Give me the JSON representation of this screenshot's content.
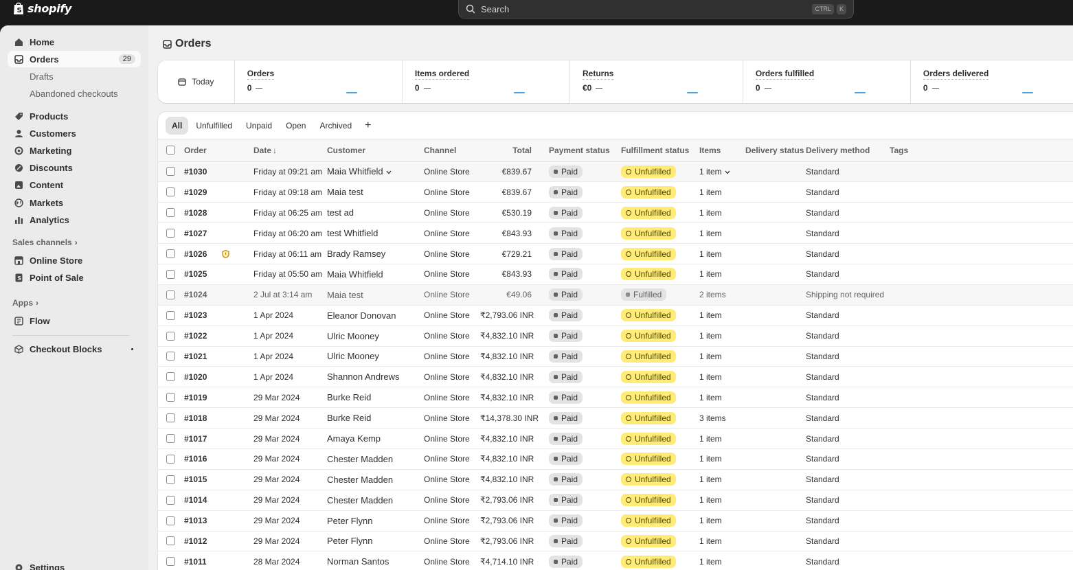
{
  "topbar": {
    "brand": "shopify",
    "search_placeholder": "Search",
    "shortcut_ctrl": "CTRL",
    "shortcut_key": "K"
  },
  "sidebar": {
    "home": "Home",
    "orders": "Orders",
    "orders_count": "29",
    "drafts": "Drafts",
    "abandoned": "Abandoned checkouts",
    "products": "Products",
    "customers": "Customers",
    "marketing": "Marketing",
    "discounts": "Discounts",
    "content": "Content",
    "markets": "Markets",
    "analytics": "Analytics",
    "sales_channels": "Sales channels",
    "online_store": "Online Store",
    "pos": "Point of Sale",
    "apps": "Apps",
    "flow": "Flow",
    "checkout_blocks": "Checkout Blocks",
    "settings": "Settings"
  },
  "page": {
    "title": "Orders"
  },
  "metrics": {
    "period": "Today",
    "items": [
      {
        "label": "Orders",
        "value": "0"
      },
      {
        "label": "Items ordered",
        "value": "0"
      },
      {
        "label": "Returns",
        "value": "€0"
      },
      {
        "label": "Orders fulfilled",
        "value": "0"
      },
      {
        "label": "Orders delivered",
        "value": "0"
      }
    ]
  },
  "tabs": [
    "All",
    "Unfulfilled",
    "Unpaid",
    "Open",
    "Archived"
  ],
  "table": {
    "headers": {
      "order": "Order",
      "date": "Date",
      "customer": "Customer",
      "channel": "Channel",
      "total": "Total",
      "payment": "Payment status",
      "fulfillment": "Fulfillment status",
      "items": "Items",
      "delivery_status": "Delivery status",
      "delivery_method": "Delivery method",
      "tags": "Tags"
    },
    "rows": [
      {
        "order": "#1030",
        "date": "Friday at 09:21 am",
        "customer": "Maia Whitfield",
        "channel": "Online Store",
        "total": "€839.67",
        "payment": "Paid",
        "fulfillment": "Unfulfilled",
        "items": "1 item",
        "delivery_method": "Standard"
      },
      {
        "order": "#1029",
        "date": "Friday at 09:18 am",
        "customer": "Maia test",
        "channel": "Online Store",
        "total": "€839.67",
        "payment": "Paid",
        "fulfillment": "Unfulfilled",
        "items": "1 item",
        "delivery_method": "Standard"
      },
      {
        "order": "#1028",
        "date": "Friday at 06:25 am",
        "customer": "test ad",
        "channel": "Online Store",
        "total": "€530.19",
        "payment": "Paid",
        "fulfillment": "Unfulfilled",
        "items": "1 item",
        "delivery_method": "Standard"
      },
      {
        "order": "#1027",
        "date": "Friday at 06:20 am",
        "customer": "test Whitfield",
        "channel": "Online Store",
        "total": "€843.93",
        "payment": "Paid",
        "fulfillment": "Unfulfilled",
        "items": "1 item",
        "delivery_method": "Standard"
      },
      {
        "order": "#1026",
        "date": "Friday at 06:11 am",
        "customer": "Brady Ramsey",
        "channel": "Online Store",
        "total": "€729.21",
        "payment": "Paid",
        "fulfillment": "Unfulfilled",
        "items": "1 item",
        "delivery_method": "Standard"
      },
      {
        "order": "#1025",
        "date": "Friday at 05:50 am",
        "customer": "Maia Whitfield",
        "channel": "Online Store",
        "total": "€843.93",
        "payment": "Paid",
        "fulfillment": "Unfulfilled",
        "items": "1 item",
        "delivery_method": "Standard"
      },
      {
        "order": "#1024",
        "date": "2 Jul at 3:14 am",
        "customer": "Maia test",
        "channel": "Online Store",
        "total": "€49.06",
        "payment": "Paid",
        "fulfillment": "Fulfilled",
        "items": "2 items",
        "delivery_method": "Shipping not required"
      },
      {
        "order": "#1023",
        "date": "1 Apr 2024",
        "customer": "Eleanor Donovan",
        "channel": "Online Store",
        "total": "₹2,793.06 INR",
        "payment": "Paid",
        "fulfillment": "Unfulfilled",
        "items": "1 item",
        "delivery_method": "Standard"
      },
      {
        "order": "#1022",
        "date": "1 Apr 2024",
        "customer": "Ulric Mooney",
        "channel": "Online Store",
        "total": "₹4,832.10 INR",
        "payment": "Paid",
        "fulfillment": "Unfulfilled",
        "items": "1 item",
        "delivery_method": "Standard"
      },
      {
        "order": "#1021",
        "date": "1 Apr 2024",
        "customer": "Ulric Mooney",
        "channel": "Online Store",
        "total": "₹4,832.10 INR",
        "payment": "Paid",
        "fulfillment": "Unfulfilled",
        "items": "1 item",
        "delivery_method": "Standard"
      },
      {
        "order": "#1020",
        "date": "1 Apr 2024",
        "customer": "Shannon Andrews",
        "channel": "Online Store",
        "total": "₹4,832.10 INR",
        "payment": "Paid",
        "fulfillment": "Unfulfilled",
        "items": "1 item",
        "delivery_method": "Standard"
      },
      {
        "order": "#1019",
        "date": "29 Mar 2024",
        "customer": "Burke Reid",
        "channel": "Online Store",
        "total": "₹4,832.10 INR",
        "payment": "Paid",
        "fulfillment": "Unfulfilled",
        "items": "1 item",
        "delivery_method": "Standard"
      },
      {
        "order": "#1018",
        "date": "29 Mar 2024",
        "customer": "Burke Reid",
        "channel": "Online Store",
        "total": "₹14,378.30 INR",
        "payment": "Paid",
        "fulfillment": "Unfulfilled",
        "items": "3 items",
        "delivery_method": "Standard"
      },
      {
        "order": "#1017",
        "date": "29 Mar 2024",
        "customer": "Amaya Kemp",
        "channel": "Online Store",
        "total": "₹4,832.10 INR",
        "payment": "Paid",
        "fulfillment": "Unfulfilled",
        "items": "1 item",
        "delivery_method": "Standard"
      },
      {
        "order": "#1016",
        "date": "29 Mar 2024",
        "customer": "Chester Madden",
        "channel": "Online Store",
        "total": "₹4,832.10 INR",
        "payment": "Paid",
        "fulfillment": "Unfulfilled",
        "items": "1 item",
        "delivery_method": "Standard"
      },
      {
        "order": "#1015",
        "date": "29 Mar 2024",
        "customer": "Chester Madden",
        "channel": "Online Store",
        "total": "₹4,832.10 INR",
        "payment": "Paid",
        "fulfillment": "Unfulfilled",
        "items": "1 item",
        "delivery_method": "Standard"
      },
      {
        "order": "#1014",
        "date": "29 Mar 2024",
        "customer": "Chester Madden",
        "channel": "Online Store",
        "total": "₹2,793.06 INR",
        "payment": "Paid",
        "fulfillment": "Unfulfilled",
        "items": "1 item",
        "delivery_method": "Standard"
      },
      {
        "order": "#1013",
        "date": "29 Mar 2024",
        "customer": "Peter Flynn",
        "channel": "Online Store",
        "total": "₹2,793.06 INR",
        "payment": "Paid",
        "fulfillment": "Unfulfilled",
        "items": "1 item",
        "delivery_method": "Standard"
      },
      {
        "order": "#1012",
        "date": "29 Mar 2024",
        "customer": "Peter Flynn",
        "channel": "Online Store",
        "total": "₹2,793.06 INR",
        "payment": "Paid",
        "fulfillment": "Unfulfilled",
        "items": "1 item",
        "delivery_method": "Standard"
      },
      {
        "order": "#1011",
        "date": "28 Mar 2024",
        "customer": "Norman Santos",
        "channel": "Online Store",
        "total": "₹4,714.10 INR",
        "payment": "Paid",
        "fulfillment": "Unfulfilled",
        "items": "1 item",
        "delivery_method": "Standard"
      }
    ]
  },
  "colors": {
    "accent_spark": "#4ba1e0",
    "unfulfilled_badge": "#ffeb78",
    "paid_badge": "#e3e3e3",
    "topbar": "#1a1a1a"
  },
  "icons": [
    "shopify-bag-icon",
    "search-icon",
    "home-icon",
    "orders-icon",
    "products-icon",
    "customers-icon",
    "marketing-icon",
    "discounts-icon",
    "content-icon",
    "markets-icon",
    "analytics-icon",
    "store-icon",
    "pos-icon",
    "flow-icon",
    "blocks-icon",
    "settings-icon",
    "calendar-icon",
    "risk-icon"
  ]
}
